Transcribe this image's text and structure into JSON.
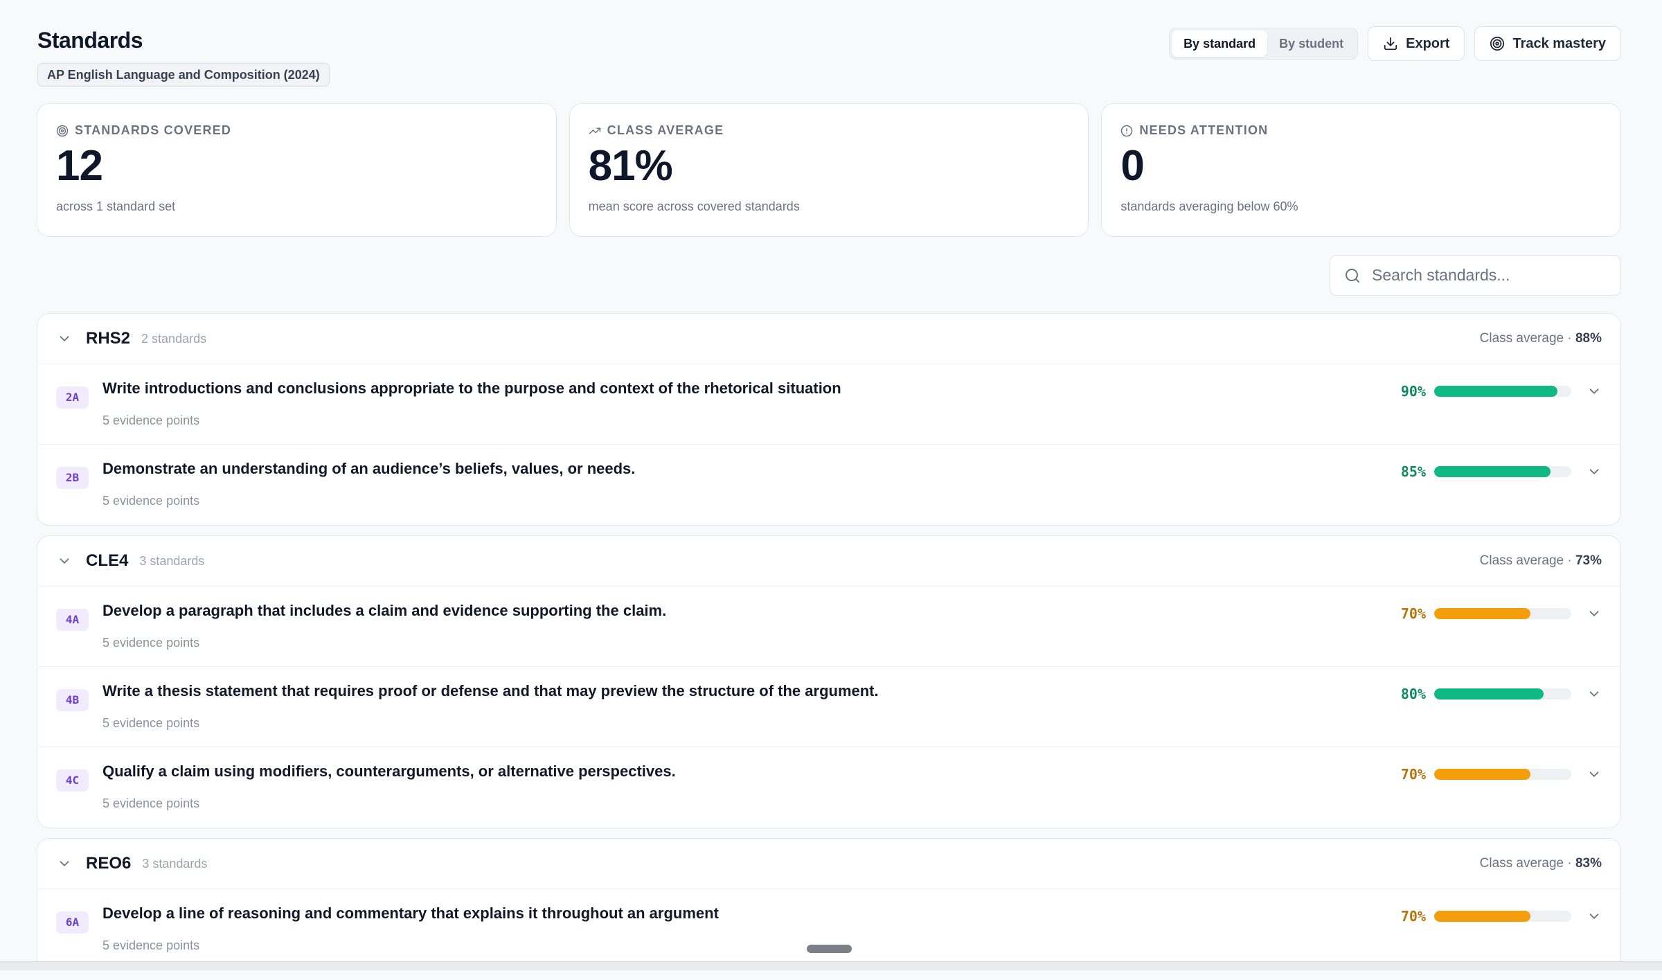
{
  "header": {
    "title": "Standards",
    "set_name": "AP English Language and Composition (2024)",
    "view_toggle": {
      "by_standard": "By standard",
      "by_student": "By student",
      "active": "by_standard"
    },
    "export_label": "Export",
    "track_label": "Track mastery"
  },
  "stats": [
    {
      "icon": "target-icon",
      "label": "STANDARDS COVERED",
      "value": "12",
      "sub": "across 1 standard set"
    },
    {
      "icon": "trending-up-icon",
      "label": "CLASS AVERAGE",
      "value": "81%",
      "sub": "mean score across covered standards"
    },
    {
      "icon": "alert-circle-icon",
      "label": "NEEDS ATTENTION",
      "value": "0",
      "sub": "standards averaging below 60%"
    }
  ],
  "search": {
    "placeholder": "Search standards..."
  },
  "colors": {
    "good": "#10b981",
    "good_text": "#0f8a60",
    "warn": "#f59e0b",
    "warn_text": "#b8740a"
  },
  "groups": [
    {
      "code": "RHS2",
      "count": "2 standards",
      "avg_label": "Class average · ",
      "avg": "88%",
      "standards": [
        {
          "code": "2A",
          "title": "Write introductions and conclusions appropriate to the purpose and context of the rhetorical situation",
          "evidence": "5 evidence points",
          "pct_label": "90%",
          "pct": 90,
          "level": "good"
        },
        {
          "code": "2B",
          "title": "Demonstrate an understanding of an audience’s beliefs, values, or needs.",
          "evidence": "5 evidence points",
          "pct_label": "85%",
          "pct": 85,
          "level": "good"
        }
      ]
    },
    {
      "code": "CLE4",
      "count": "3 standards",
      "avg_label": "Class average · ",
      "avg": "73%",
      "standards": [
        {
          "code": "4A",
          "title": "Develop a paragraph that includes a claim and evidence supporting the claim.",
          "evidence": "5 evidence points",
          "pct_label": "70%",
          "pct": 70,
          "level": "warn"
        },
        {
          "code": "4B",
          "title": "Write a thesis statement that requires proof or defense and that may preview the structure of the argument.",
          "evidence": "5 evidence points",
          "pct_label": "80%",
          "pct": 80,
          "level": "good"
        },
        {
          "code": "4C",
          "title": "Qualify a claim using modifiers, counterarguments, or alternative perspectives.",
          "evidence": "5 evidence points",
          "pct_label": "70%",
          "pct": 70,
          "level": "warn"
        }
      ]
    },
    {
      "code": "REO6",
      "count": "3 standards",
      "avg_label": "Class average · ",
      "avg": "83%",
      "standards": [
        {
          "code": "6A",
          "title": "Develop a line of reasoning and commentary that explains it throughout an argument",
          "evidence": "5 evidence points",
          "pct_label": "70%",
          "pct": 70,
          "level": "warn"
        }
      ]
    }
  ]
}
